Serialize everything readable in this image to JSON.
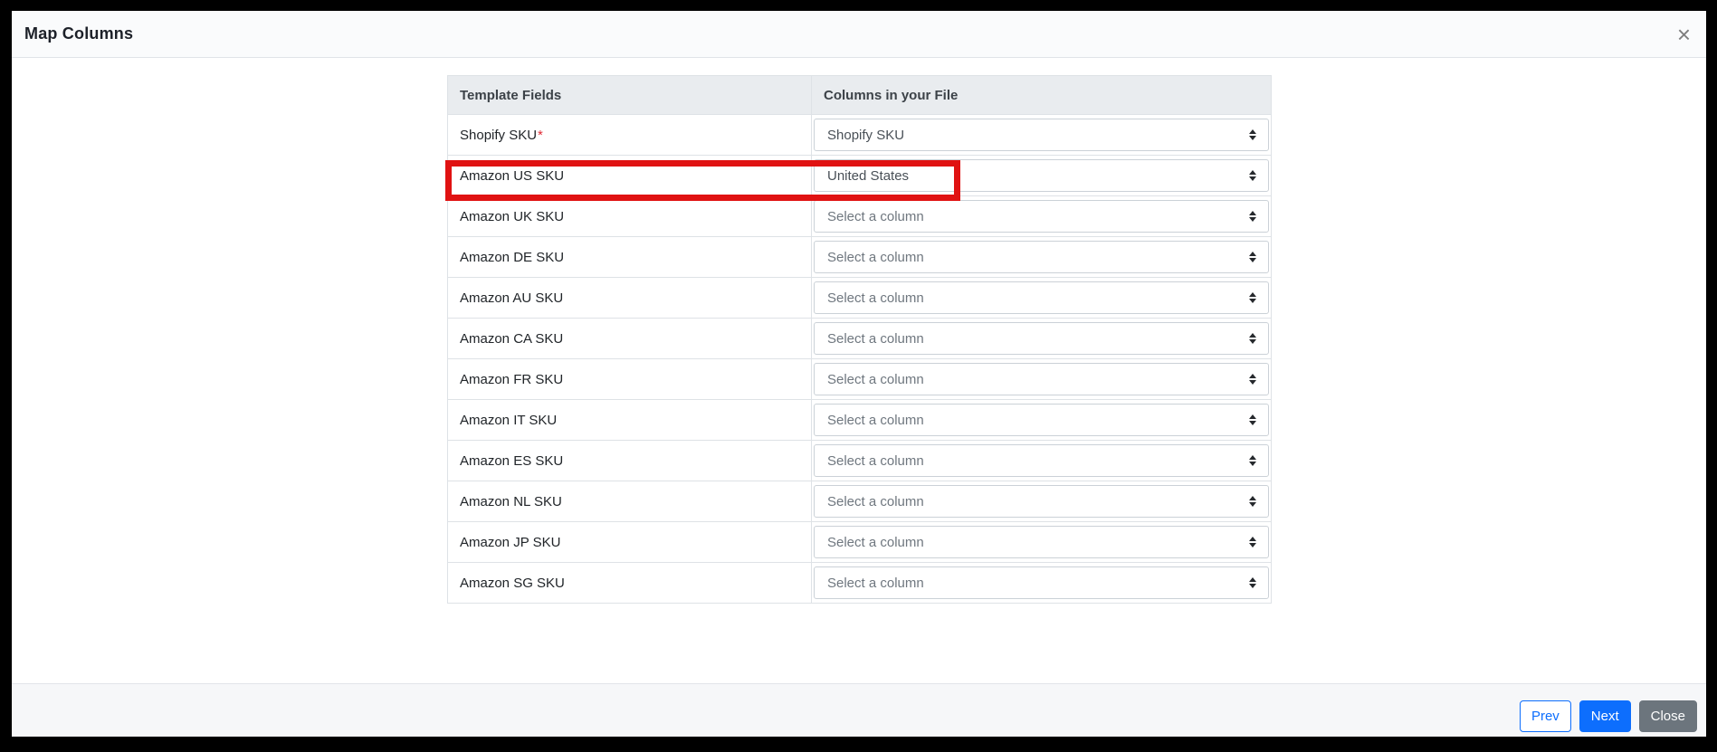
{
  "modal": {
    "title": "Map Columns",
    "close_icon": "×"
  },
  "table": {
    "headers": [
      "Template Fields",
      "Columns in your File"
    ],
    "required_marker": "*",
    "rows": [
      {
        "field": "Shopify SKU",
        "required": true,
        "value": "Shopify SKU",
        "is_placeholder": false,
        "highlighted": false
      },
      {
        "field": "Amazon US SKU",
        "required": false,
        "value": "United States",
        "is_placeholder": false,
        "highlighted": true
      },
      {
        "field": "Amazon UK SKU",
        "required": false,
        "value": "Select a column",
        "is_placeholder": true,
        "highlighted": false
      },
      {
        "field": "Amazon DE SKU",
        "required": false,
        "value": "Select a column",
        "is_placeholder": true,
        "highlighted": false
      },
      {
        "field": "Amazon AU SKU",
        "required": false,
        "value": "Select a column",
        "is_placeholder": true,
        "highlighted": false
      },
      {
        "field": "Amazon CA SKU",
        "required": false,
        "value": "Select a column",
        "is_placeholder": true,
        "highlighted": false
      },
      {
        "field": "Amazon FR SKU",
        "required": false,
        "value": "Select a column",
        "is_placeholder": true,
        "highlighted": false
      },
      {
        "field": "Amazon IT SKU",
        "required": false,
        "value": "Select a column",
        "is_placeholder": true,
        "highlighted": false
      },
      {
        "field": "Amazon ES SKU",
        "required": false,
        "value": "Select a column",
        "is_placeholder": true,
        "highlighted": false
      },
      {
        "field": "Amazon NL SKU",
        "required": false,
        "value": "Select a column",
        "is_placeholder": true,
        "highlighted": false
      },
      {
        "field": "Amazon JP SKU",
        "required": false,
        "value": "Select a column",
        "is_placeholder": true,
        "highlighted": false
      },
      {
        "field": "Amazon SG SKU",
        "required": false,
        "value": "Select a column",
        "is_placeholder": true,
        "highlighted": false
      }
    ]
  },
  "annotation": {
    "type": "highlight-box",
    "highlighted_row": "Amazon US SKU",
    "color": "#e01212"
  },
  "footer": {
    "buttons": [
      {
        "label": "Prev",
        "style": "outline-primary"
      },
      {
        "label": "Next",
        "style": "primary"
      },
      {
        "label": "Close",
        "style": "secondary"
      }
    ]
  },
  "colors": {
    "accent_primary": "#0d6efd",
    "secondary_button": "#6c757d",
    "required_asterisk": "#e02b35",
    "table_header_bg": "#e9ecef",
    "table_border": "#dee2e6",
    "annotation_red": "#e01212",
    "frame_border": "#000000"
  }
}
